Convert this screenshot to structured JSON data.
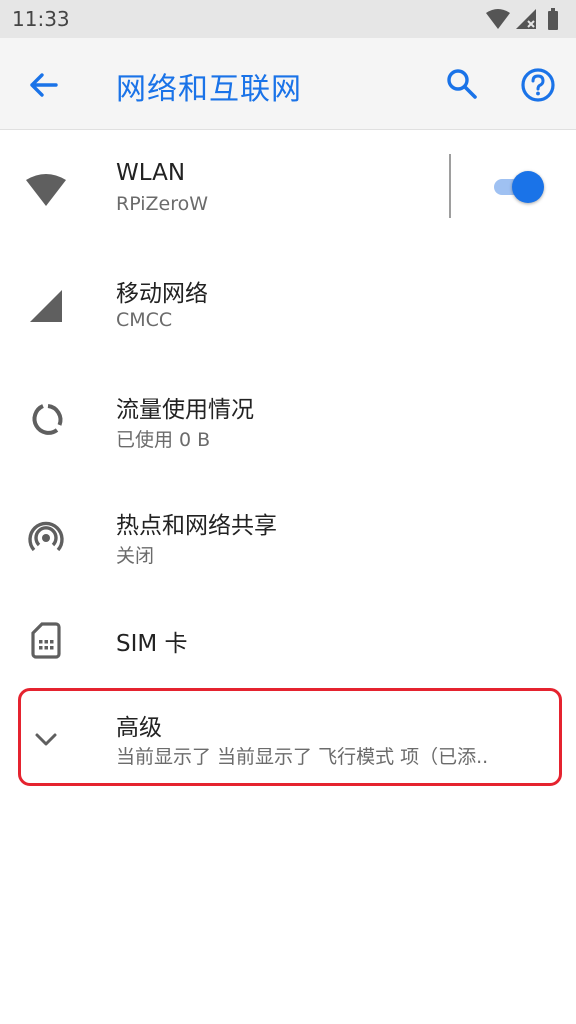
{
  "status_bar": {
    "time": "11:33",
    "icons": [
      "wifi-icon",
      "cellular-signal-icon",
      "battery-icon"
    ]
  },
  "app_bar": {
    "title": "网络和互联网",
    "back_icon": "arrow-back-icon",
    "search_icon": "search-icon",
    "help_icon": "help-icon",
    "accent_color": "#1a73e8"
  },
  "items": [
    {
      "key": "wlan",
      "icon": "wifi-icon",
      "title": "WLAN",
      "subtitle": "RPiZeroW",
      "toggle_on": true
    },
    {
      "key": "mobile",
      "icon": "cellular-signal-icon",
      "title": "移动网络",
      "subtitle": "CMCC"
    },
    {
      "key": "data_usage",
      "icon": "data-usage-icon",
      "title": "流量使用情况",
      "subtitle": "已使用 0 B"
    },
    {
      "key": "hotspot",
      "icon": "hotspot-icon",
      "title": "热点和网络共享",
      "subtitle": "关闭"
    },
    {
      "key": "sim",
      "icon": "sim-card-icon",
      "title": "SIM 卡"
    },
    {
      "key": "advanced",
      "icon": "chevron-down-icon",
      "title": "高级",
      "subtitle": "当前显示了 当前显示了 飞行模式 项（已添.."
    }
  ],
  "highlight_color": "#e5232f"
}
